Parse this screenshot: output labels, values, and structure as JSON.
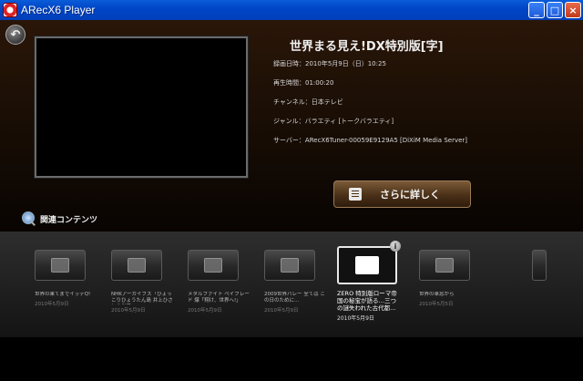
{
  "window": {
    "title": "ARecX6 Player",
    "minimize_label": "_",
    "maximize_label": "□",
    "close_label": "×"
  },
  "back_button": {
    "glyph": "↶"
  },
  "program": {
    "title": "世界まる見え!DX特別版[字]",
    "recorded": "録画日時：2010年5月9日（日）10:25",
    "duration": "再生時間：01:00:20",
    "channel": "チャンネル：日本テレビ",
    "genre": "ジャンル：バラエティ [トークバラエティ]",
    "server": "サーバー：ARecX6Tuner-00059E9129A5 [DiXiM Media Server]"
  },
  "more_button": {
    "label": "さらに詳しく",
    "icon": "list-icon"
  },
  "related": {
    "label": "関連コンテンツ",
    "items": [
      {
        "title": "世界の果てまでイッテQ!",
        "date": "2010年5月9日",
        "icon": "grid-icon"
      },
      {
        "title": "NHKアーカイブス「ひょっこりひょうたん島 井上ひさしの世界」",
        "date": "2010年5月9日",
        "icon": "film-icon"
      },
      {
        "title": "メタルファイト ベイブレード 爆「翔け、世界へ!」",
        "date": "2010年5月9日",
        "icon": "clock-icon"
      },
      {
        "title": "2009世界バレー 全ては この日のために…",
        "date": "2010年5月9日",
        "icon": "image-icon"
      },
      {
        "title": "ZERO 特別版ローマ帝国の秘宝が語る…三つの謎失われた古代都…",
        "date": "2010年5月9日",
        "icon": "person-icon",
        "selected": true,
        "badge": "i"
      },
      {
        "title": "世界の車窓から",
        "date": "2010年5月5日",
        "icon": "film-icon"
      },
      {
        "title": "",
        "date": "",
        "icon": "film-icon"
      }
    ]
  },
  "colors": {
    "titlebar": "#0046c8",
    "background_top": "#2a1608",
    "button_brown": "#4a3018",
    "carousel": "#1e1e1e"
  }
}
